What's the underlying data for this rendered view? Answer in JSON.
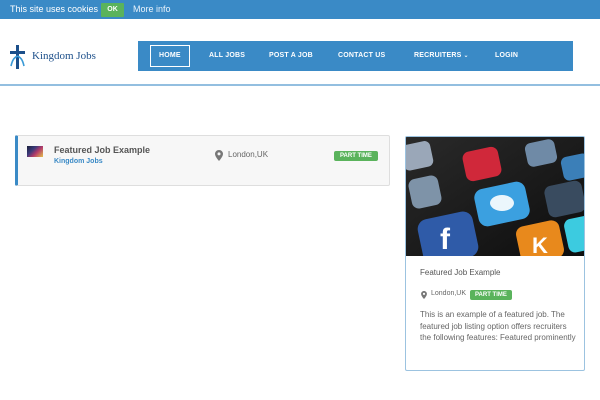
{
  "cookie_bar": {
    "message": "This site uses cookies",
    "ok_label": "OK",
    "more_info_label": "More info"
  },
  "brand": {
    "name": "Kingdom Jobs",
    "primary_color": "#3a8ac6"
  },
  "nav": {
    "items": [
      {
        "label": "HOME",
        "active": true
      },
      {
        "label": "ALL JOBS"
      },
      {
        "label": "POST A JOB"
      },
      {
        "label": "CONTACT US"
      },
      {
        "label": "RECRUITERS",
        "has_dropdown": true
      },
      {
        "label": "LOGIN"
      }
    ]
  },
  "job_list": {
    "items": [
      {
        "title": "Featured Job Example",
        "company": "Kingdom Jobs",
        "location": "London,UK",
        "type": "PART TIME",
        "type_color": "#5ab35c"
      }
    ]
  },
  "featured_job": {
    "image_icon": "smartphone-apps-photo",
    "title": "Featured Job Example",
    "location": "London,UK",
    "type": "PART TIME",
    "description": "This is an example of a featured job. The featured job listing option offers recruiters the following features: Featured prominently"
  }
}
